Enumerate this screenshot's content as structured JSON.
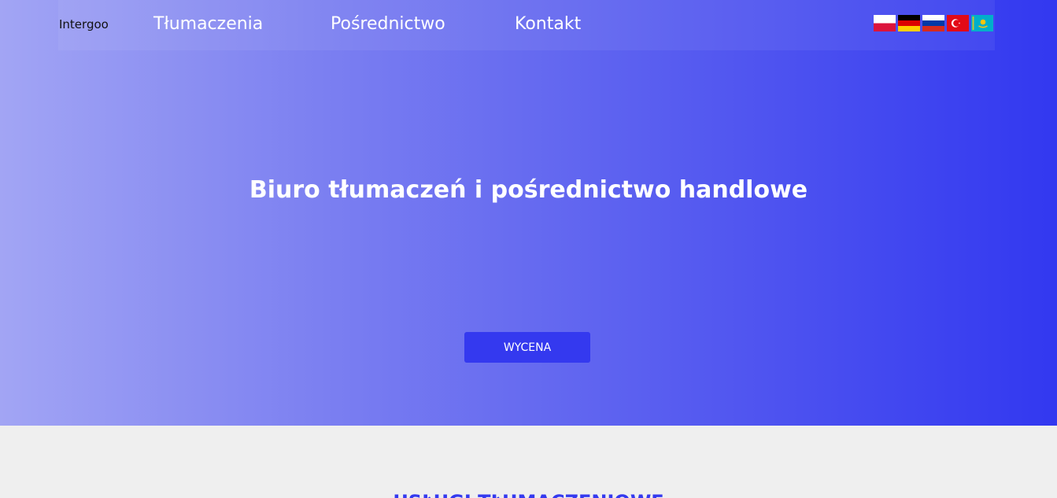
{
  "header": {
    "logo": "Intergoo",
    "nav": [
      {
        "label": "Tłumaczenia"
      },
      {
        "label": "Pośrednictwo"
      },
      {
        "label": "Kontakt"
      }
    ],
    "flags": [
      {
        "icon": "flag-poland-icon"
      },
      {
        "icon": "flag-germany-icon"
      },
      {
        "icon": "flag-russia-icon"
      },
      {
        "icon": "flag-turkey-icon"
      },
      {
        "icon": "flag-kazakhstan-icon"
      }
    ]
  },
  "hero": {
    "title": "Biuro tłumaczeń i pośrednictwo handlowe",
    "cta_label": "WYCENA"
  },
  "services": {
    "title": "USŁUGI TŁUMACZENIOWE"
  },
  "colors": {
    "accent": "#3439ef",
    "gradient_start": "#a2a5f4",
    "gradient_end": "#3238f0",
    "lower_bg": "#efefef"
  }
}
